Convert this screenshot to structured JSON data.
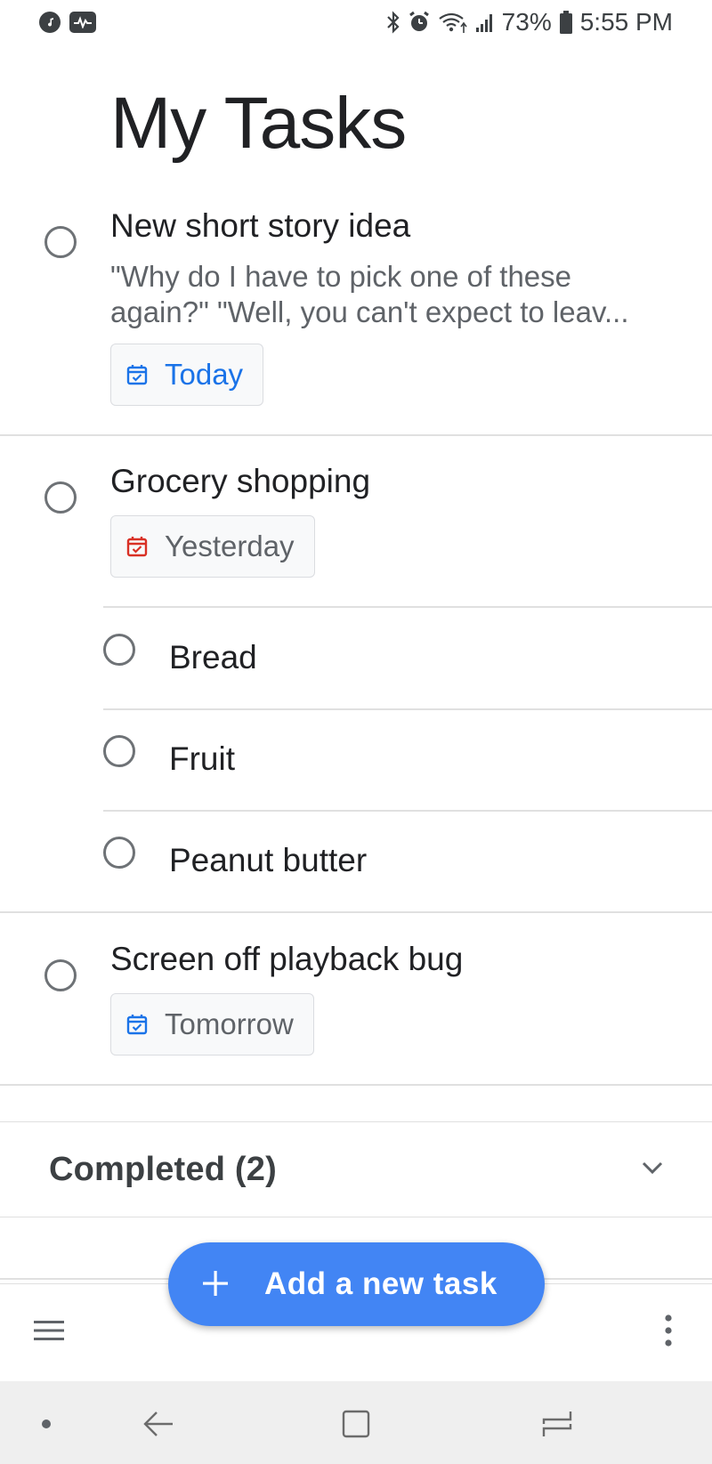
{
  "status_bar": {
    "battery": "73%",
    "time": "5:55 PM"
  },
  "page": {
    "title": "My Tasks"
  },
  "tasks": [
    {
      "title": "New short story idea",
      "notes_line1": "\"Why do I have to pick one of these",
      "notes_line2": "again?\" \"Well, you can't expect to leav...",
      "due": "Today",
      "due_color": "#1a73e8"
    },
    {
      "title": "Grocery shopping",
      "due": "Yesterday",
      "due_color": "#d93025",
      "subtasks": [
        {
          "title": "Bread"
        },
        {
          "title": "Fruit"
        },
        {
          "title": "Peanut butter"
        }
      ]
    },
    {
      "title": "Screen off playback bug",
      "due": "Tomorrow",
      "due_color": "#1a73e8"
    }
  ],
  "completed": {
    "label": "Completed (2)"
  },
  "fab": {
    "label": "Add a new task",
    "color": "#4285f4"
  },
  "icons": {
    "menu": "menu-icon",
    "more": "more-vert-icon",
    "chevron": "chevron-down-icon",
    "add": "plus-icon"
  }
}
